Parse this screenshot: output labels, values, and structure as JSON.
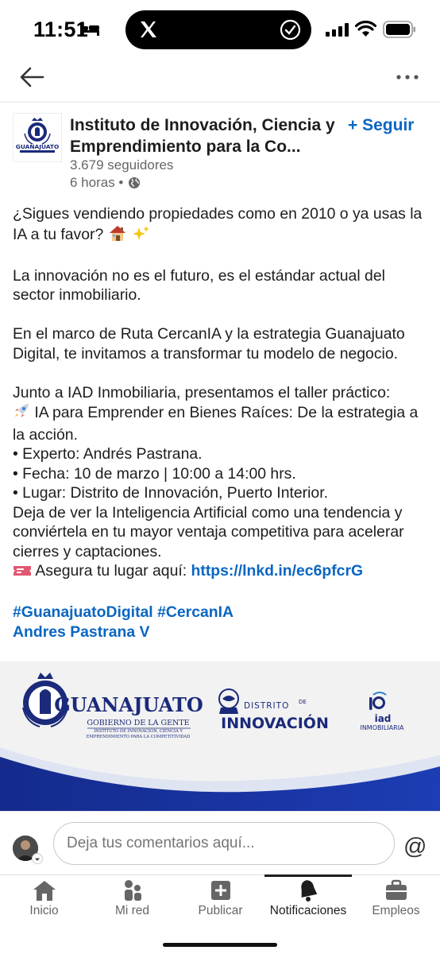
{
  "status_bar": {
    "time": "11:51"
  },
  "post": {
    "author_name": "Instituto de Innovación, Ciencia y Emprendimiento para la Co...",
    "follow_label": "+ Seguir",
    "followers": "3.679 seguidores",
    "posted": "6 horas •",
    "body": {
      "intro": "¿Sigues vendiendo propiedades como en 2010 o ya usas la IA a tu favor?",
      "p2": "La innovación no es el futuro, es el estándar actual del sector inmobiliario.",
      "p3": "En el marco de Ruta CercanIA y la estrategia Guanajuato Digital, te invitamos a transformar tu modelo de negocio.",
      "p4_line1": "Junto a IAD Inmobiliaria, presentamos el taller práctico:",
      "p4_line2": "IA para Emprender en Bienes Raíces: De la estrategia a la acción.",
      "bullet1": "• Experto: Andrés Pastrana.",
      "bullet2": "• Fecha: 10 de marzo | 10:00 a 14:00 hrs.",
      "bullet3": "• Lugar: Distrito de Innovación, Puerto Interior.",
      "p5": "Deja de ver la Inteligencia Artificial como una tendencia y conviértela en tu mayor ventaja competitiva para acelerar cierres y captaciones.",
      "cta": "Asegura tu lugar aquí:",
      "link": "https://lnkd.in/ec6pfcrG",
      "hashtags": "#GuanajuatoDigital #CercanIA",
      "mention": "Andres Pastrana V"
    },
    "banner": {
      "logo1_main": "GUANAJUATO",
      "logo1_sub": "GOBIERNO DE LA GENTE",
      "logo1_small_1": "INSTITUTO DE INNOVACIÓN, CIENCIA Y",
      "logo1_small_2": "EMPRENDIMIENTO PARA LA COMPETITIVIDAD",
      "logo2_top": "DISTRITO",
      "logo2_de": "DE",
      "logo2_main": "INNOVACIÓN",
      "logo3_main": "iad",
      "logo3_sub": "INMOBILIARIA",
      "avatar_logo_text": "GUANAJUATO"
    }
  },
  "comment": {
    "placeholder": "Deja tus comentarios aquí...",
    "at_symbol": "@"
  },
  "tabs": [
    {
      "label": "Inicio",
      "icon": "home-icon"
    },
    {
      "label": "Mi red",
      "icon": "network-icon"
    },
    {
      "label": "Publicar",
      "icon": "plus-square-icon"
    },
    {
      "label": "Notificaciones",
      "icon": "bell-icon"
    },
    {
      "label": "Empleos",
      "icon": "briefcase-icon"
    }
  ],
  "colors": {
    "link_blue": "#0a66c2",
    "banner_navy": "#1b2a7a",
    "text": "#1d1d1d"
  }
}
